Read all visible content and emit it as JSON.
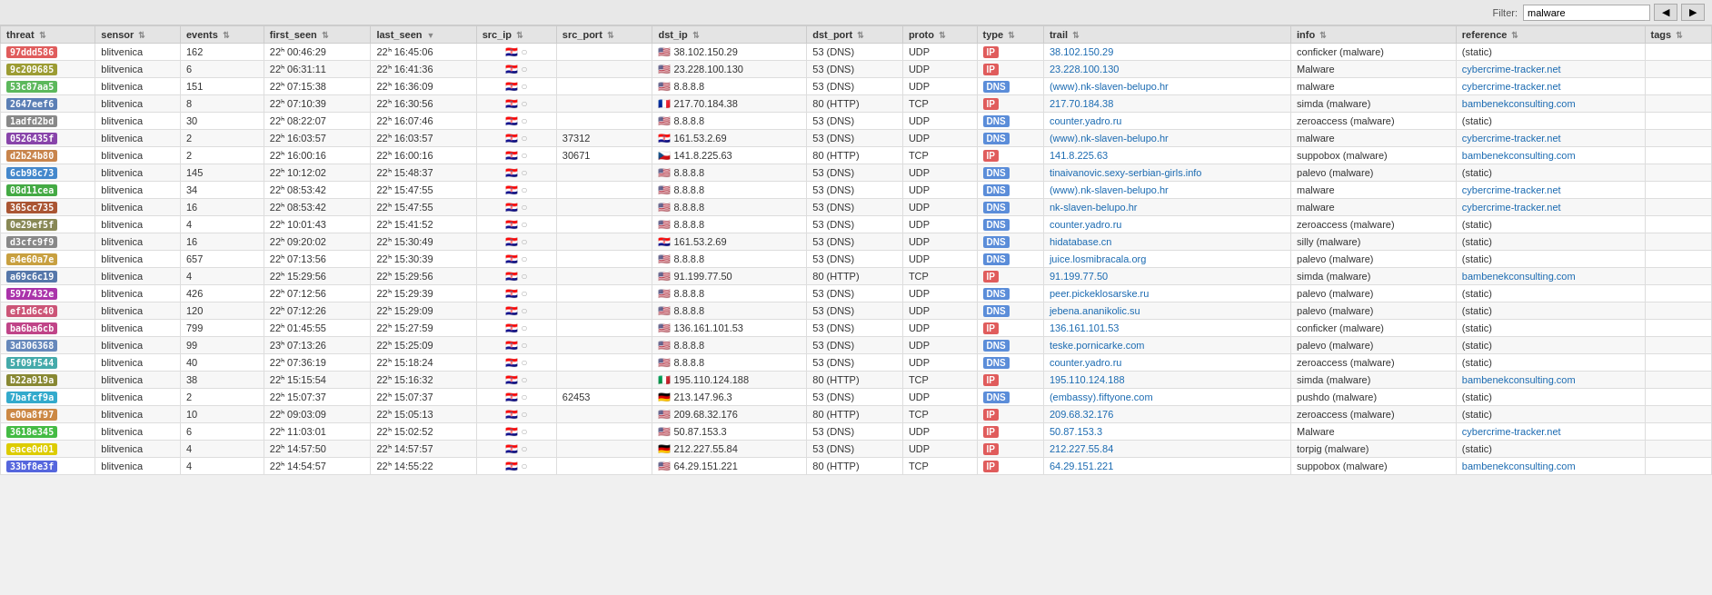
{
  "topbar": {
    "filter_label": "Filter:",
    "filter_value": "malware",
    "btn1": "◀",
    "btn2": "▶"
  },
  "table": {
    "columns": [
      {
        "key": "threat",
        "label": "threat"
      },
      {
        "key": "sensor",
        "label": "sensor"
      },
      {
        "key": "events",
        "label": "events"
      },
      {
        "key": "first_seen",
        "label": "first_seen"
      },
      {
        "key": "last_seen",
        "label": "last_seen"
      },
      {
        "key": "src_ip",
        "label": "src_ip"
      },
      {
        "key": "src_port",
        "label": "src_port"
      },
      {
        "key": "dst_ip",
        "label": "dst_ip"
      },
      {
        "key": "dst_port",
        "label": "dst_port"
      },
      {
        "key": "proto",
        "label": "proto"
      },
      {
        "key": "type",
        "label": "type"
      },
      {
        "key": "trail",
        "label": "trail"
      },
      {
        "key": "info",
        "label": "info"
      },
      {
        "key": "reference",
        "label": "reference"
      },
      {
        "key": "tags",
        "label": "tags"
      }
    ],
    "rows": [
      {
        "threat": "97ddd586",
        "threat_color": "#e05c5c",
        "sensor": "blitvenica",
        "events": "162",
        "first_seen": "22ʰ 00:46:29",
        "last_seen": "22ʰ 16:45:06",
        "src_flag": "🇭🇷",
        "src_chat": "💬",
        "src_port": "",
        "dst_ip": "38.102.150.29",
        "dst_flag": "🇺🇸",
        "dst_port": "53 (DNS)",
        "proto": "UDP",
        "type": "IP",
        "type_color": "type-ip",
        "trail": "38.102.150.29",
        "info": "conficker (malware)",
        "reference": "(static)",
        "tags": ""
      },
      {
        "threat": "9c209685",
        "threat_color": "#9c9c33",
        "sensor": "blitvenica",
        "events": "6",
        "first_seen": "22ʰ 06:31:11",
        "last_seen": "22ʰ 16:41:36",
        "src_flag": "🇭🇷",
        "src_chat": "💬",
        "src_port": "",
        "dst_ip": "23.228.100.130",
        "dst_flag": "🇺🇸",
        "dst_port": "53 (DNS)",
        "proto": "UDP",
        "type": "IP",
        "type_color": "type-ip",
        "trail": "23.228.100.130",
        "info": "Malware",
        "reference": "cybercrime-tracker.net",
        "tags": ""
      },
      {
        "threat": "53c87aa5",
        "threat_color": "#5cb85c",
        "sensor": "blitvenica",
        "events": "151",
        "first_seen": "22ʰ 07:15:38",
        "last_seen": "22ʰ 16:36:09",
        "src_flag": "🇭🇷",
        "src_chat": "💬",
        "src_port": "",
        "dst_ip": "8.8.8.8",
        "dst_flag": "🇺🇸",
        "dst_port": "53 (DNS)",
        "proto": "UDP",
        "type": "DNS",
        "type_color": "type-dns",
        "trail": "(www).nk-slaven-belupo.hr",
        "info": "malware",
        "reference": "cybercrime-tracker.net",
        "tags": ""
      },
      {
        "threat": "2647eef6",
        "threat_color": "#5b7fb5",
        "sensor": "blitvenica",
        "events": "8",
        "first_seen": "22ʰ 07:10:39",
        "last_seen": "22ʰ 16:30:56",
        "src_flag": "🇭🇷",
        "src_chat": "💬",
        "src_port": "",
        "dst_ip": "217.70.184.38",
        "dst_flag": "🇫🇷",
        "dst_port": "80 (HTTP)",
        "proto": "TCP",
        "type": "IP",
        "type_color": "type-ip",
        "trail": "217.70.184.38",
        "info": "simda (malware)",
        "reference": "bambenekconsulting.com",
        "tags": ""
      },
      {
        "threat": "1adfd2bd",
        "threat_color": "#888888",
        "sensor": "blitvenica",
        "events": "30",
        "first_seen": "22ʰ 08:22:07",
        "last_seen": "22ʰ 16:07:46",
        "src_flag": "🇭🇷",
        "src_chat": "💬",
        "src_port": "",
        "dst_ip": "8.8.8.8",
        "dst_flag": "🇺🇸",
        "dst_port": "53 (DNS)",
        "proto": "UDP",
        "type": "DNS",
        "type_color": "type-dns",
        "trail": "counter.yadro.ru",
        "info": "zeroaccess (malware)",
        "reference": "(static)",
        "tags": ""
      },
      {
        "threat": "0526435f",
        "threat_color": "#8844aa",
        "sensor": "blitvenica",
        "events": "2",
        "first_seen": "22ʰ 16:03:57",
        "last_seen": "22ʰ 16:03:57",
        "src_flag": "🇭🇷",
        "src_chat": "💬",
        "src_port": "37312",
        "dst_ip": "161.53.2.69",
        "dst_flag": "🇭🇷",
        "dst_port": "53 (DNS)",
        "proto": "UDP",
        "type": "DNS",
        "type_color": "type-dns",
        "trail": "(www).nk-slaven-belupo.hr",
        "info": "malware",
        "reference": "cybercrime-tracker.net",
        "tags": ""
      },
      {
        "threat": "d2b24b80",
        "threat_color": "#c8844c",
        "sensor": "blitvenica",
        "events": "2",
        "first_seen": "22ʰ 16:00:16",
        "last_seen": "22ʰ 16:00:16",
        "src_flag": "🇭🇷",
        "src_chat": "💬",
        "src_port": "30671",
        "dst_ip": "141.8.225.63",
        "dst_flag": "🇨🇿",
        "dst_port": "80 (HTTP)",
        "proto": "TCP",
        "type": "IP",
        "type_color": "type-ip",
        "trail": "141.8.225.63",
        "info": "suppobox (malware)",
        "reference": "bambenekconsulting.com",
        "tags": ""
      },
      {
        "threat": "6cb98c73",
        "threat_color": "#4488cc",
        "sensor": "blitvenica",
        "events": "145",
        "first_seen": "22ʰ 10:12:02",
        "last_seen": "22ʰ 15:48:37",
        "src_flag": "🇭🇷",
        "src_chat": "💬",
        "src_port": "",
        "dst_ip": "8.8.8.8",
        "dst_flag": "🇺🇸",
        "dst_port": "53 (DNS)",
        "proto": "UDP",
        "type": "DNS",
        "type_color": "type-dns",
        "trail": "tinaivanovic.sexy-serbian-girls.info",
        "info": "palevo (malware)",
        "reference": "(static)",
        "tags": ""
      },
      {
        "threat": "08d11cea",
        "threat_color": "#44aa44",
        "sensor": "blitvenica",
        "events": "34",
        "first_seen": "22ʰ 08:53:42",
        "last_seen": "22ʰ 15:47:55",
        "src_flag": "🇭🇷",
        "src_chat": "💬",
        "src_port": "",
        "dst_ip": "8.8.8.8",
        "dst_flag": "🇺🇸",
        "dst_port": "53 (DNS)",
        "proto": "UDP",
        "type": "DNS",
        "type_color": "type-dns",
        "trail": "(www).nk-slaven-belupo.hr",
        "info": "malware",
        "reference": "cybercrime-tracker.net",
        "tags": ""
      },
      {
        "threat": "365cc735",
        "threat_color": "#aa5533",
        "sensor": "blitvenica",
        "events": "16",
        "first_seen": "22ʰ 08:53:42",
        "last_seen": "22ʰ 15:47:55",
        "src_flag": "🇭🇷",
        "src_chat": "💬",
        "src_port": "",
        "dst_ip": "8.8.8.8",
        "dst_flag": "🇺🇸",
        "dst_port": "53 (DNS)",
        "proto": "UDP",
        "type": "DNS",
        "type_color": "type-dns",
        "trail": "nk-slaven-belupo.hr",
        "info": "malware",
        "reference": "cybercrime-tracker.net",
        "tags": ""
      },
      {
        "threat": "0e29ef5f",
        "threat_color": "#888855",
        "sensor": "blitvenica",
        "events": "4",
        "first_seen": "22ʰ 10:01:43",
        "last_seen": "22ʰ 15:41:52",
        "src_flag": "🇭🇷",
        "src_chat": "💬",
        "src_port": "",
        "dst_ip": "8.8.8.8",
        "dst_flag": "🇺🇸",
        "dst_port": "53 (DNS)",
        "proto": "UDP",
        "type": "DNS",
        "type_color": "type-dns",
        "trail": "counter.yadro.ru",
        "info": "zeroaccess (malware)",
        "reference": "(static)",
        "tags": ""
      },
      {
        "threat": "d3cfc9f9",
        "threat_color": "#888888",
        "sensor": "blitvenica",
        "events": "16",
        "first_seen": "22ʰ 09:20:02",
        "last_seen": "22ʰ 15:30:49",
        "src_flag": "🇭🇷",
        "src_chat": "💬",
        "src_port": "",
        "dst_ip": "161.53.2.69",
        "dst_flag": "🇭🇷",
        "dst_port": "53 (DNS)",
        "proto": "UDP",
        "type": "DNS",
        "type_color": "type-dns",
        "trail": "hidatabase.cn",
        "info": "silly (malware)",
        "reference": "(static)",
        "tags": ""
      },
      {
        "threat": "a4e60a7e",
        "threat_color": "#c8a040",
        "sensor": "blitvenica",
        "events": "657",
        "first_seen": "22ʰ 07:13:56",
        "last_seen": "22ʰ 15:30:39",
        "src_flag": "🇭🇷",
        "src_chat": "💬",
        "src_port": "",
        "dst_ip": "8.8.8.8",
        "dst_flag": "🇺🇸",
        "dst_port": "53 (DNS)",
        "proto": "UDP",
        "type": "DNS",
        "type_color": "type-dns",
        "trail": "juice.losmibracala.org",
        "info": "palevo (malware)",
        "reference": "(static)",
        "tags": ""
      },
      {
        "threat": "a69c6c19",
        "threat_color": "#5577aa",
        "sensor": "blitvenica",
        "events": "4",
        "first_seen": "22ʰ 15:29:56",
        "last_seen": "22ʰ 15:29:56",
        "src_flag": "🇭🇷",
        "src_chat": "💬",
        "src_port": "",
        "dst_ip": "91.199.77.50",
        "dst_flag": "🇺🇸",
        "dst_port": "80 (HTTP)",
        "proto": "TCP",
        "type": "IP",
        "type_color": "type-ip",
        "trail": "91.199.77.50",
        "info": "simda (malware)",
        "reference": "bambenekconsulting.com",
        "tags": ""
      },
      {
        "threat": "5977432e",
        "threat_color": "#aa33aa",
        "sensor": "blitvenica",
        "events": "426",
        "first_seen": "22ʰ 07:12:56",
        "last_seen": "22ʰ 15:29:39",
        "src_flag": "🇭🇷",
        "src_chat": "💬",
        "src_port": "",
        "dst_ip": "8.8.8.8",
        "dst_flag": "🇺🇸",
        "dst_port": "53 (DNS)",
        "proto": "UDP",
        "type": "DNS",
        "type_color": "type-dns",
        "trail": "peer.pickeklosarske.ru",
        "info": "palevo (malware)",
        "reference": "(static)",
        "tags": ""
      },
      {
        "threat": "ef1d6c40",
        "threat_color": "#cc5577",
        "sensor": "blitvenica",
        "events": "120",
        "first_seen": "22ʰ 07:12:26",
        "last_seen": "22ʰ 15:29:09",
        "src_flag": "🇭🇷",
        "src_chat": "💬",
        "src_port": "",
        "dst_ip": "8.8.8.8",
        "dst_flag": "🇺🇸",
        "dst_port": "53 (DNS)",
        "proto": "UDP",
        "type": "DNS",
        "type_color": "type-dns",
        "trail": "jebena.ananikolic.su",
        "info": "palevo (malware)",
        "reference": "(static)",
        "tags": ""
      },
      {
        "threat": "ba6ba6cb",
        "threat_color": "#c04488",
        "sensor": "blitvenica",
        "events": "799",
        "first_seen": "22ʰ 01:45:55",
        "last_seen": "22ʰ 15:27:59",
        "src_flag": "🇭🇷",
        "src_chat": "💬",
        "src_port": "",
        "dst_ip": "136.161.101.53",
        "dst_flag": "🇺🇸",
        "dst_port": "53 (DNS)",
        "proto": "UDP",
        "type": "IP",
        "type_color": "type-ip",
        "trail": "136.161.101.53",
        "info": "conficker (malware)",
        "reference": "(static)",
        "tags": ""
      },
      {
        "threat": "3d306368",
        "threat_color": "#6688bb",
        "sensor": "blitvenica",
        "events": "99",
        "first_seen": "23ʰ 07:13:26",
        "last_seen": "22ʰ 15:25:09",
        "src_flag": "🇭🇷",
        "src_chat": "💬",
        "src_port": "",
        "dst_ip": "8.8.8.8",
        "dst_flag": "🇺🇸",
        "dst_port": "53 (DNS)",
        "proto": "UDP",
        "type": "DNS",
        "type_color": "type-dns",
        "trail": "teske.pornicarke.com",
        "info": "palevo (malware)",
        "reference": "(static)",
        "tags": ""
      },
      {
        "threat": "5f09f544",
        "threat_color": "#44aaaa",
        "sensor": "blitvenica",
        "events": "40",
        "first_seen": "22ʰ 07:36:19",
        "last_seen": "22ʰ 15:18:24",
        "src_flag": "🇭🇷",
        "src_chat": "💬",
        "src_port": "",
        "dst_ip": "8.8.8.8",
        "dst_flag": "🇺🇸",
        "dst_port": "53 (DNS)",
        "proto": "UDP",
        "type": "DNS",
        "type_color": "type-dns",
        "trail": "counter.yadro.ru",
        "info": "zeroaccess (malware)",
        "reference": "(static)",
        "tags": ""
      },
      {
        "threat": "b22a919a",
        "threat_color": "#888833",
        "sensor": "blitvenica",
        "events": "38",
        "first_seen": "22ʰ 15:15:54",
        "last_seen": "22ʰ 15:16:32",
        "src_flag": "🇭🇷",
        "src_chat": "💬",
        "src_port": "",
        "dst_ip": "195.110.124.188",
        "dst_flag": "🇮🇹",
        "dst_port": "80 (HTTP)",
        "proto": "TCP",
        "type": "IP",
        "type_color": "type-ip",
        "trail": "195.110.124.188",
        "info": "simda (malware)",
        "reference": "bambenekconsulting.com",
        "tags": ""
      },
      {
        "threat": "7bafcf9a",
        "threat_color": "#33aacc",
        "sensor": "blitvenica",
        "events": "2",
        "first_seen": "22ʰ 15:07:37",
        "last_seen": "22ʰ 15:07:37",
        "src_flag": "🇭🇷",
        "src_chat": "💬",
        "src_port": "62453",
        "dst_ip": "213.147.96.3",
        "dst_flag": "🇩🇪",
        "dst_port": "53 (DNS)",
        "proto": "UDP",
        "type": "DNS",
        "type_color": "type-dns",
        "trail": "(embassy).fiftyone.com",
        "info": "pushdo (malware)",
        "reference": "(static)",
        "tags": ""
      },
      {
        "threat": "e00a8f97",
        "threat_color": "#cc8844",
        "sensor": "blitvenica",
        "events": "10",
        "first_seen": "22ʰ 09:03:09",
        "last_seen": "22ʰ 15:05:13",
        "src_flag": "🇭🇷",
        "src_chat": "💬",
        "src_port": "",
        "dst_ip": "209.68.32.176",
        "dst_flag": "🇺🇸",
        "dst_port": "80 (HTTP)",
        "proto": "TCP",
        "type": "IP",
        "type_color": "type-ip",
        "trail": "209.68.32.176",
        "info": "zeroaccess (malware)",
        "reference": "(static)",
        "tags": ""
      },
      {
        "threat": "3618e345",
        "threat_color": "#44bb44",
        "sensor": "blitvenica",
        "events": "6",
        "first_seen": "22ʰ 11:03:01",
        "last_seen": "22ʰ 15:02:52",
        "src_flag": "🇭🇷",
        "src_chat": "💬",
        "src_port": "",
        "dst_ip": "50.87.153.3",
        "dst_flag": "🇺🇸",
        "dst_port": "53 (DNS)",
        "proto": "UDP",
        "type": "IP",
        "type_color": "type-ip",
        "trail": "50.87.153.3",
        "info": "Malware",
        "reference": "cybercrime-tracker.net",
        "tags": ""
      },
      {
        "threat": "eace0d01",
        "threat_color": "#ddcc00",
        "sensor": "blitvenica",
        "events": "4",
        "first_seen": "22ʰ 14:57:50",
        "last_seen": "22ʰ 14:57:57",
        "src_flag": "🇭🇷",
        "src_chat": "💬",
        "src_port": "",
        "dst_ip": "212.227.55.84",
        "dst_flag": "🇩🇪",
        "dst_port": "53 (DNS)",
        "proto": "UDP",
        "type": "IP",
        "type_color": "type-ip",
        "trail": "212.227.55.84",
        "info": "torpig (malware)",
        "reference": "(static)",
        "tags": ""
      },
      {
        "threat": "33bf8e3f",
        "threat_color": "#5566dd",
        "sensor": "blitvenica",
        "events": "4",
        "first_seen": "22ʰ 14:54:57",
        "last_seen": "22ʰ 14:55:22",
        "src_flag": "🇭🇷",
        "src_chat": "💬",
        "src_port": "",
        "dst_ip": "64.29.151.221",
        "dst_flag": "🇺🇸",
        "dst_port": "80 (HTTP)",
        "proto": "TCP",
        "type": "IP",
        "type_color": "type-ip",
        "trail": "64.29.151.221",
        "info": "suppobox (malware)",
        "reference": "bambenekconsulting.com",
        "tags": ""
      }
    ]
  }
}
